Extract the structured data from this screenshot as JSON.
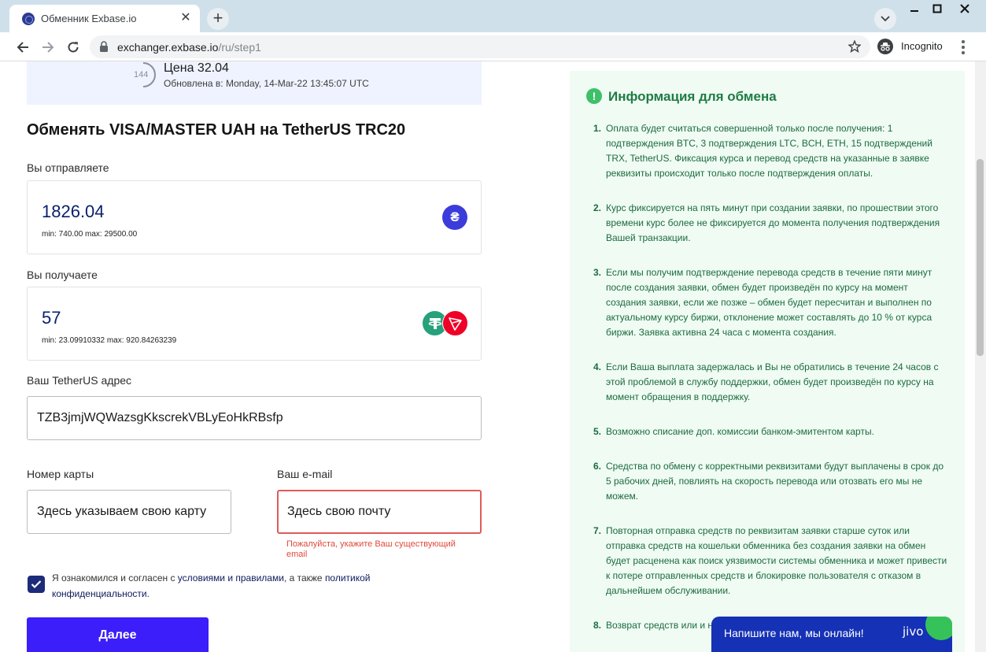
{
  "browser": {
    "tab_title": "Обменник Exbase.io",
    "url_host": "exchanger.exbase.io",
    "url_path": "/ru/step1",
    "incognito_label": "Incognito"
  },
  "rate": {
    "countdown": "144",
    "price": "Цена 32.04",
    "updated": "Обновлена в: Monday, 14-Mar-22 13:45:07 UTC"
  },
  "form": {
    "title": "Обменять VISA/MASTER UAH на TetherUS TRC20",
    "send": {
      "label": "Вы отправляете",
      "value": "1826.04",
      "limits": "min: 740.00   max: 29500.00",
      "currency_symbol": "₴"
    },
    "receive": {
      "label": "Вы получаете",
      "value": "57",
      "limits": "min: 23.09910332   max: 920.84263239"
    },
    "address": {
      "label": "Ваш TetherUS адрес",
      "value": "TZB3jmjWQWazsgKkscrekVBLyEoHkRBsfp"
    },
    "card": {
      "label": "Номер карты",
      "value": "Здесь указываем свою карту"
    },
    "email": {
      "label": "Ваш e-mail",
      "value": "Здесь свою почту",
      "error": "Пожалуйста, укажите Ваш существующий email"
    },
    "agreement": {
      "checked": true,
      "text_1": "Я ознакомился и согласен с ",
      "link_1": "условиями и правилами",
      "text_2": ", а также ",
      "link_2": "политикой конфиденциальности",
      "text_3": "."
    },
    "submit_label": "Далее"
  },
  "info": {
    "title": "Информация для обмена",
    "items": [
      {
        "n": "1.",
        "text": "Оплата будет считаться совершенной только после получения: 1 подтверждения BTC, 3 подтверждения LTC, BCH, ETH, 15 подтверждений TRX, TetherUS. Фиксация курса и перевод средств на указанные в заявке реквизиты происходит только после подтверждения оплаты."
      },
      {
        "n": "2.",
        "text": "Курс фиксируется на пять минут при создании заявки, по прошествии этого времени курс более не фиксируется до момента получения подтверждения Вашей транзакции."
      },
      {
        "n": "3.",
        "text": "Если мы получим подтверждение перевода средств в течение пяти минут после создания заявки, обмен будет произведён по курсу на момент создания заявки, если же позже – обмен будет пересчитан и выполнен по актуальному курсу биржи, отклонение может составлять до 10 % от курса биржи. Заявка активна 24 часа с момента создания."
      },
      {
        "n": "4.",
        "text": "Если Ваша выплата задержалась и Вы не обратились в течение 24 часов с этой проблемой в службу поддержки, обмен будет произведён по курсу на момент обращения в поддержку."
      },
      {
        "n": "5.",
        "text": "Возможно списание доп. комиссии банком-эмитентом карты."
      },
      {
        "n": "6.",
        "text": "Средства по обмену с корректными реквизитами будут выплачены в срок до 5 рабочих дней, повлиять на скорость перевода или отозвать его мы не можем."
      },
      {
        "n": "7.",
        "text": "Повторная отправка средств по реквизитам заявки старше суток или отправка средств на кошельки обменника без создания заявки на обмен будет расценена как поиск уязвимости системы обменника и может привести к потере отправленных средств и блокировке пользователя с отказом в дальнейшем обслуживании."
      },
      {
        "n": "8.",
        "text": "Возврат средств или и невозможности выпла"
      }
    ]
  },
  "chat": {
    "text": "Напишите нам, мы онлайн!",
    "logo": "jivo"
  },
  "colors": {
    "accent": "#3c1efa",
    "info_green": "#1d6b3e",
    "error": "#e05a5a"
  }
}
